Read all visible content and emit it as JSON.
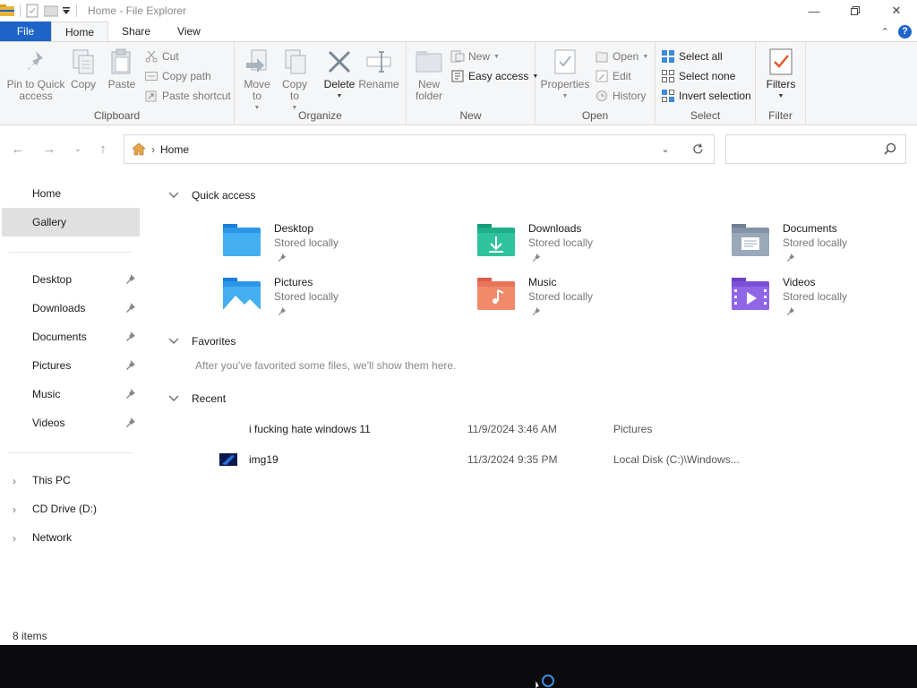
{
  "window": {
    "title": "Home - File Explorer"
  },
  "ribbon_tabs": [
    {
      "label": "File"
    },
    {
      "label": "Home"
    },
    {
      "label": "Share"
    },
    {
      "label": "View"
    }
  ],
  "ribbon": {
    "clipboard": {
      "label": "Clipboard",
      "pin": "Pin to Quick access",
      "copy": "Copy",
      "paste": "Paste",
      "cut": "Cut",
      "copy_path": "Copy path",
      "paste_shortcut": "Paste shortcut"
    },
    "organize": {
      "label": "Organize",
      "move_to": "Move to",
      "copy_to": "Copy to",
      "delete": "Delete",
      "rename": "Rename"
    },
    "new": {
      "label": "New",
      "new_folder": "New folder",
      "new_item": "New",
      "easy_access": "Easy access"
    },
    "open": {
      "label": "Open",
      "properties": "Properties",
      "open": "Open",
      "edit": "Edit",
      "history": "History"
    },
    "select": {
      "label": "Select",
      "select_all": "Select all",
      "select_none": "Select none",
      "invert": "Invert selection"
    },
    "filter": {
      "label": "Filter",
      "filters": "Filters"
    }
  },
  "address": {
    "path": "Home",
    "search_placeholder": ""
  },
  "sidebar": {
    "top": [
      {
        "label": "Home"
      },
      {
        "label": "Gallery"
      }
    ],
    "pinned": [
      {
        "label": "Desktop"
      },
      {
        "label": "Downloads"
      },
      {
        "label": "Documents"
      },
      {
        "label": "Pictures"
      },
      {
        "label": "Music"
      },
      {
        "label": "Videos"
      }
    ],
    "drives": [
      {
        "label": "This PC"
      },
      {
        "label": "CD Drive (D:)"
      },
      {
        "label": "Network"
      }
    ]
  },
  "content": {
    "quick_access_header": "Quick access",
    "quick_access": [
      {
        "name": "Desktop",
        "sub": "Stored locally"
      },
      {
        "name": "Downloads",
        "sub": "Stored locally"
      },
      {
        "name": "Documents",
        "sub": "Stored locally"
      },
      {
        "name": "Pictures",
        "sub": "Stored locally"
      },
      {
        "name": "Music",
        "sub": "Stored locally"
      },
      {
        "name": "Videos",
        "sub": "Stored locally"
      }
    ],
    "favorites_header": "Favorites",
    "favorites_note": "After you've favorited some files, we'll show them here.",
    "recent_header": "Recent",
    "recent": [
      {
        "name": "i fucking hate windows 11",
        "date": "11/9/2024 3:46 AM",
        "location": "Pictures"
      },
      {
        "name": "img19",
        "date": "11/3/2024 9:35 PM",
        "location": "Local Disk (C:)\\Windows..."
      }
    ]
  },
  "status": {
    "items": "8 items"
  }
}
